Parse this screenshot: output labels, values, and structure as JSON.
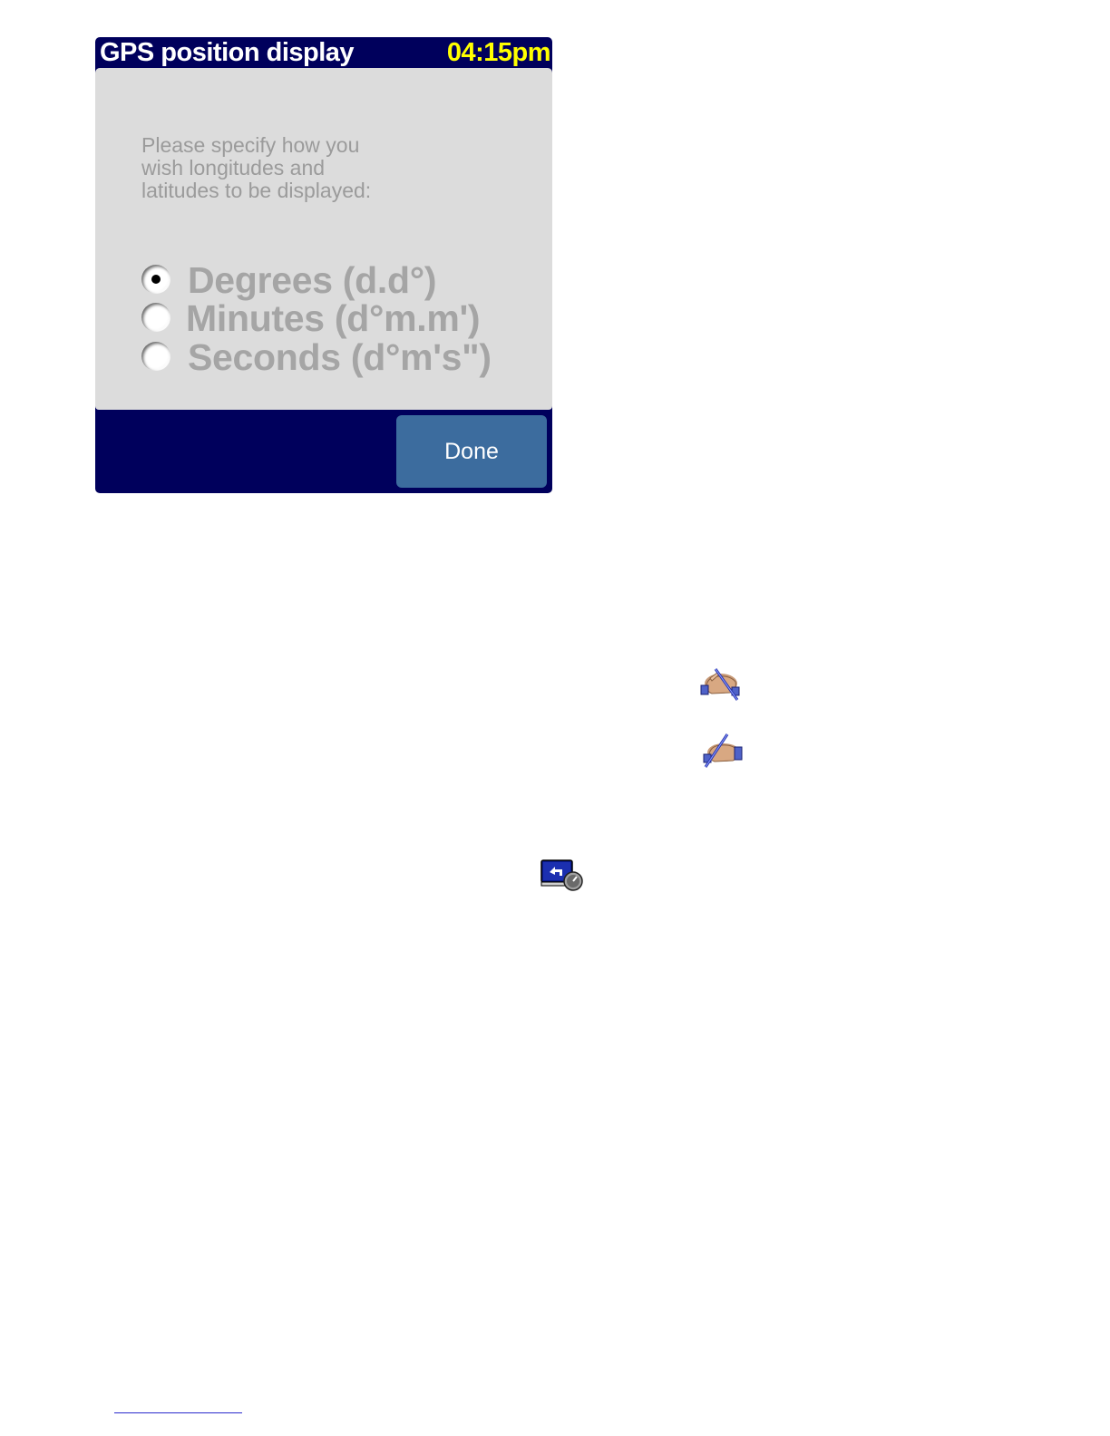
{
  "window": {
    "title": "GPS position display",
    "clock": "04:15pm"
  },
  "prompt": "Please specify how you\nwish longitudes and\nlatitudes to be displayed:",
  "options": [
    {
      "label": "Degrees (d.d°)",
      "selected": true
    },
    {
      "label": "Minutes (d°m.m')",
      "selected": false
    },
    {
      "label": "Seconds (d°m's\")",
      "selected": false
    }
  ],
  "actions": {
    "done_label": "Done"
  },
  "colors": {
    "titlebar_bg": "#00005c",
    "clock": "#ffff00",
    "panel_bg": "#dcdcdc",
    "done_button": "#3c6c9e"
  },
  "icons": {
    "hand_1": "hand-stylus-tap-icon",
    "hand_2": "hand-stylus-drag-icon",
    "back": "back-screen-icon"
  }
}
